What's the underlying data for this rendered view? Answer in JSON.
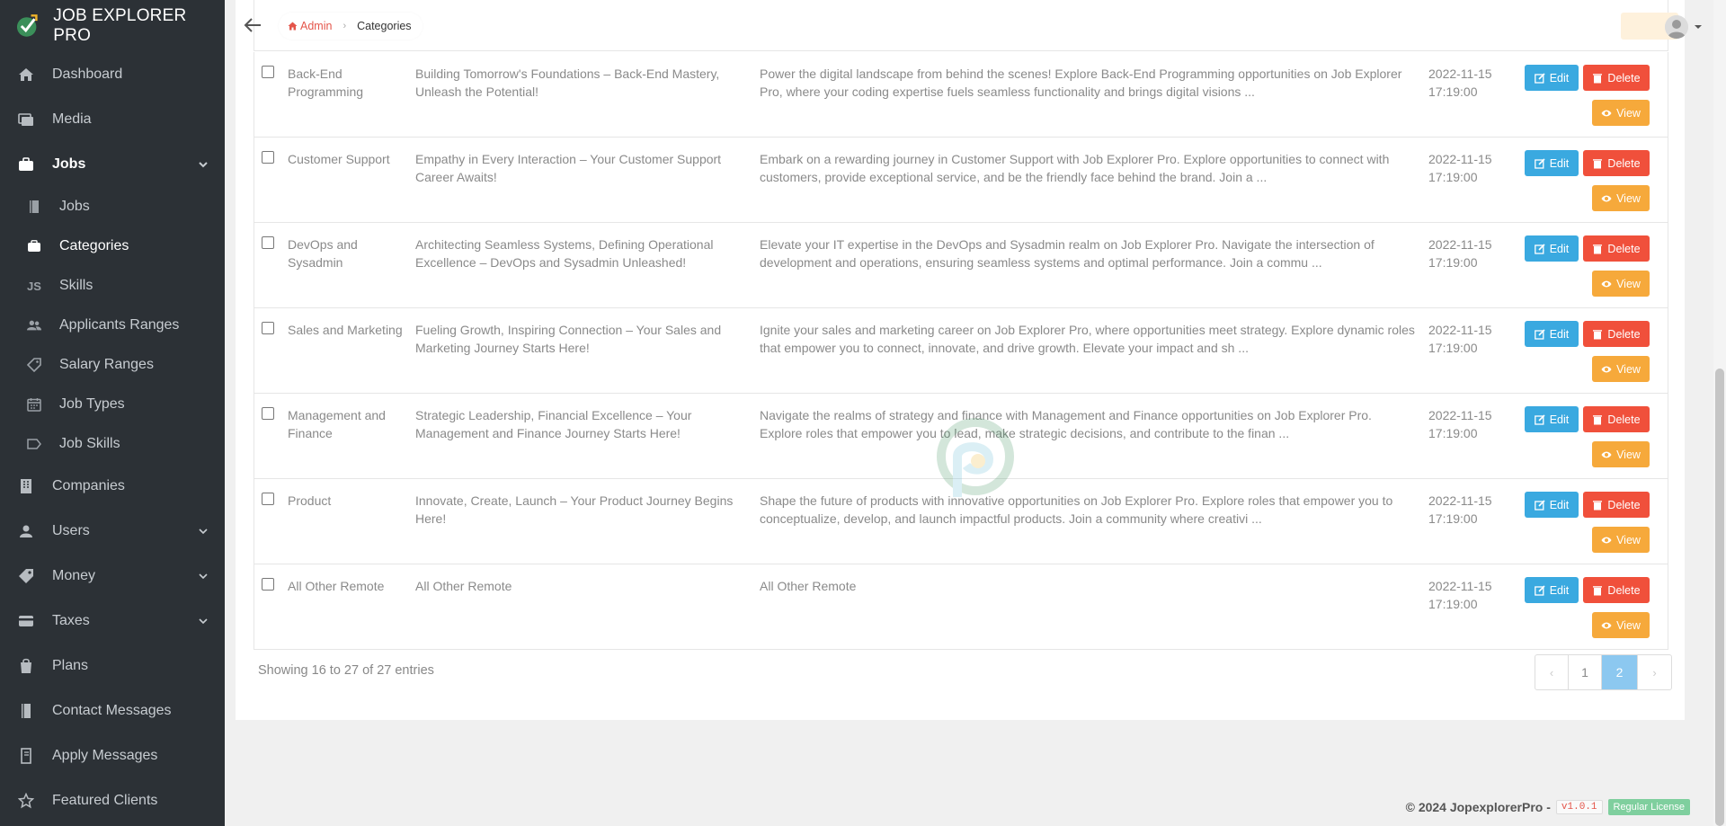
{
  "app": {
    "brand": "JOB EXPLORER PRO"
  },
  "sidebar": {
    "items": [
      {
        "label": "Dashboard",
        "icon": "home-icon"
      },
      {
        "label": "Media",
        "icon": "image-icon"
      },
      {
        "label": "Jobs",
        "icon": "briefcase-icon",
        "expanded": true
      },
      {
        "label": "Companies",
        "icon": "building-icon"
      },
      {
        "label": "Users",
        "icon": "user-icon"
      },
      {
        "label": "Money",
        "icon": "tag-icon"
      },
      {
        "label": "Taxes",
        "icon": "card-icon"
      },
      {
        "label": "Plans",
        "icon": "bag-icon"
      },
      {
        "label": "Contact Messages",
        "icon": "book-icon"
      },
      {
        "label": "Apply Messages",
        "icon": "book-open-icon"
      },
      {
        "label": "Featured Clients",
        "icon": "star-icon"
      }
    ],
    "jobs_sub": [
      {
        "label": "Jobs",
        "icon": "book-icon"
      },
      {
        "label": "Categories",
        "icon": "briefcase-icon",
        "current": true
      },
      {
        "label": "Skills",
        "icon": "js-icon"
      },
      {
        "label": "Applicants Ranges",
        "icon": "users-icon"
      },
      {
        "label": "Salary Ranges",
        "icon": "tag-icon"
      },
      {
        "label": "Job Types",
        "icon": "calendar-icon"
      },
      {
        "label": "Job Skills",
        "icon": "label-icon"
      }
    ]
  },
  "breadcrumb": {
    "home": "Admin",
    "current": "Categories"
  },
  "table": {
    "rows": [
      {
        "name": "Back-End Programming",
        "title": "Building Tomorrow's Foundations – Back-End Mastery, Unleash the Potential!",
        "description": "Power the digital landscape from behind the scenes! Explore Back-End Programming opportunities on Job Explorer Pro, where your coding expertise fuels seamless functionality and brings digital visions ...",
        "date": "2022-11-15",
        "time": "17:19:00"
      },
      {
        "name": "Customer Support",
        "title": "Empathy in Every Interaction – Your Customer Support Career Awaits!",
        "description": "Embark on a rewarding journey in Customer Support with Job Explorer Pro. Explore opportunities to connect with customers, provide exceptional service, and be the friendly face behind the brand. Join a ...",
        "date": "2022-11-15",
        "time": "17:19:00"
      },
      {
        "name": "DevOps and Sysadmin",
        "title": "Architecting Seamless Systems, Defining Operational Excellence – DevOps and Sysadmin Unleashed!",
        "description": "Elevate your IT expertise in the DevOps and Sysadmin realm on Job Explorer Pro. Navigate the intersection of development and operations, ensuring seamless systems and optimal performance. Join a commu ...",
        "date": "2022-11-15",
        "time": "17:19:00"
      },
      {
        "name": "Sales and Marketing",
        "title": "Fueling Growth, Inspiring Connection – Your Sales and Marketing Journey Starts Here!",
        "description": "Ignite your sales and marketing career on Job Explorer Pro, where opportunities meet strategy. Explore dynamic roles that empower you to connect, innovate, and drive growth. Elevate your impact and sh ...",
        "date": "2022-11-15",
        "time": "17:19:00"
      },
      {
        "name": "Management and Finance",
        "title": "Strategic Leadership, Financial Excellence – Your Management and Finance Journey Starts Here!",
        "description": "Navigate the realms of strategy and finance with Management and Finance opportunities on Job Explorer Pro. Explore roles that empower you to lead, make strategic decisions, and contribute to the finan ...",
        "date": "2022-11-15",
        "time": "17:19:00"
      },
      {
        "name": "Product",
        "title": "Innovate, Create, Launch – Your Product Journey Begins Here!",
        "description": "Shape the future of products with innovative opportunities on Job Explorer Pro. Explore roles that empower you to conceptualize, develop, and launch impactful products. Join a community where creativi ...",
        "date": "2022-11-15",
        "time": "17:19:00"
      },
      {
        "name": "All Other Remote",
        "title": "All Other Remote",
        "description": "All Other Remote",
        "date": "2022-11-15",
        "time": "17:19:00"
      }
    ],
    "actions": {
      "edit": "Edit",
      "delete": "Delete",
      "view": "View"
    }
  },
  "footer": {
    "info": "Showing 16 to 27 of 27 entries",
    "pages": [
      "‹",
      "1",
      "2",
      "›"
    ],
    "active_page": "2",
    "copyright": "© 2024 JopexplorerPro -",
    "version": "v1.0.1",
    "license": "Regular License"
  },
  "colors": {
    "sidebar_bg": "#2c3136",
    "edit": "#3aa9e0",
    "delete": "#f0503b",
    "view": "#f6a93b",
    "page_active": "#8cc8f0"
  }
}
